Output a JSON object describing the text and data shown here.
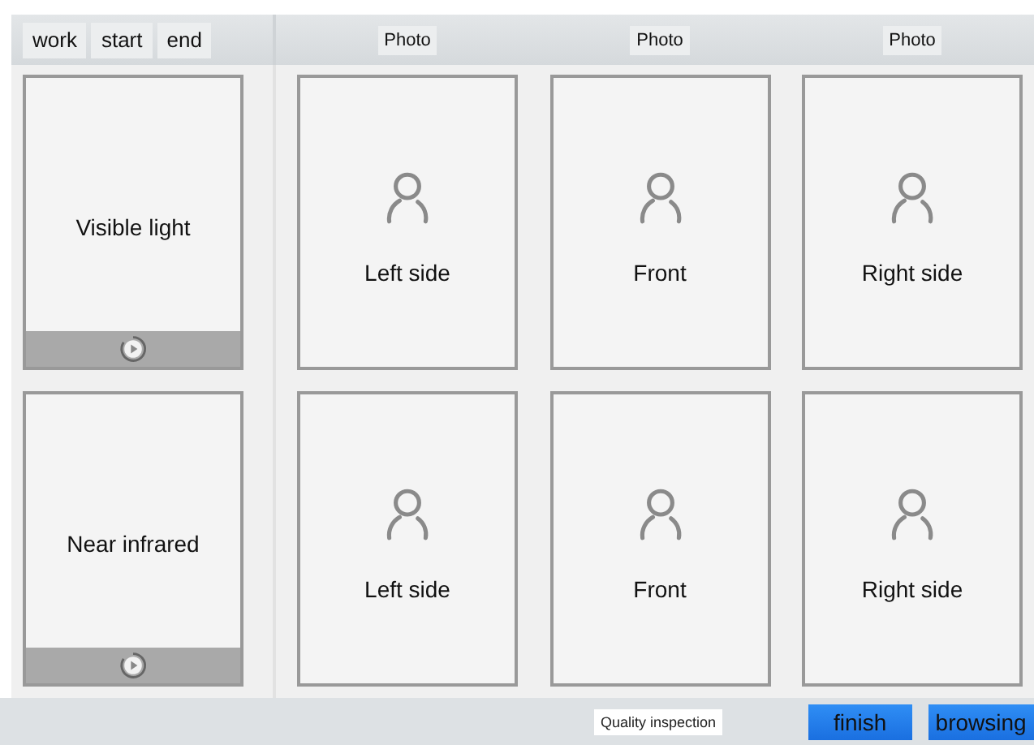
{
  "toolbar": {
    "buttons": [
      "work",
      "start",
      "end"
    ]
  },
  "photo_headers": [
    "Photo",
    "Photo",
    "Photo"
  ],
  "video_panels": [
    {
      "label": "Visible light"
    },
    {
      "label": "Near infrared"
    }
  ],
  "photo_slots": [
    {
      "label": "Left side"
    },
    {
      "label": "Front"
    },
    {
      "label": "Right side"
    },
    {
      "label": "Left side"
    },
    {
      "label": "Front"
    },
    {
      "label": "Right side"
    }
  ],
  "footer": {
    "status": "Quality inspection",
    "buttons": [
      "finish",
      "browsing"
    ]
  }
}
